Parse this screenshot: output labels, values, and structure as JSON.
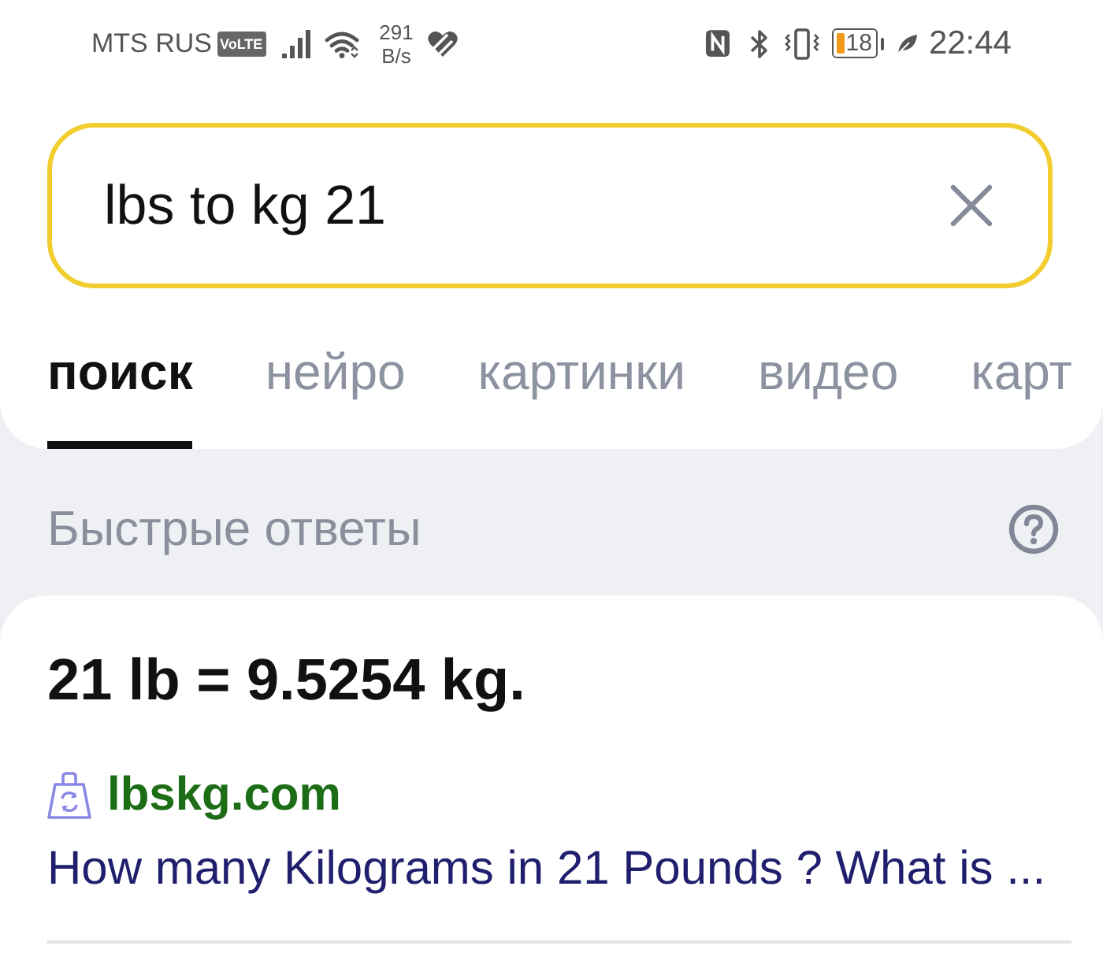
{
  "status_bar": {
    "carrier": "MTS RUS",
    "network_badge": "VoLTE",
    "data_rate": "291",
    "data_rate_unit": "B/s",
    "battery_percent": "18",
    "time": "22:44"
  },
  "search": {
    "value": "lbs to kg 21"
  },
  "tabs": [
    {
      "label": "поиск",
      "selected": true
    },
    {
      "label": "нейро",
      "selected": false
    },
    {
      "label": "картинки",
      "selected": false
    },
    {
      "label": "видео",
      "selected": false
    },
    {
      "label": "карт",
      "selected": false
    }
  ],
  "quick_answers": {
    "title": "Быстрые ответы",
    "result": "21 lb = 9.5254 kg.",
    "source": "lbskg.com",
    "link": "How many Kilograms in 21 Pounds ? What is ..."
  }
}
